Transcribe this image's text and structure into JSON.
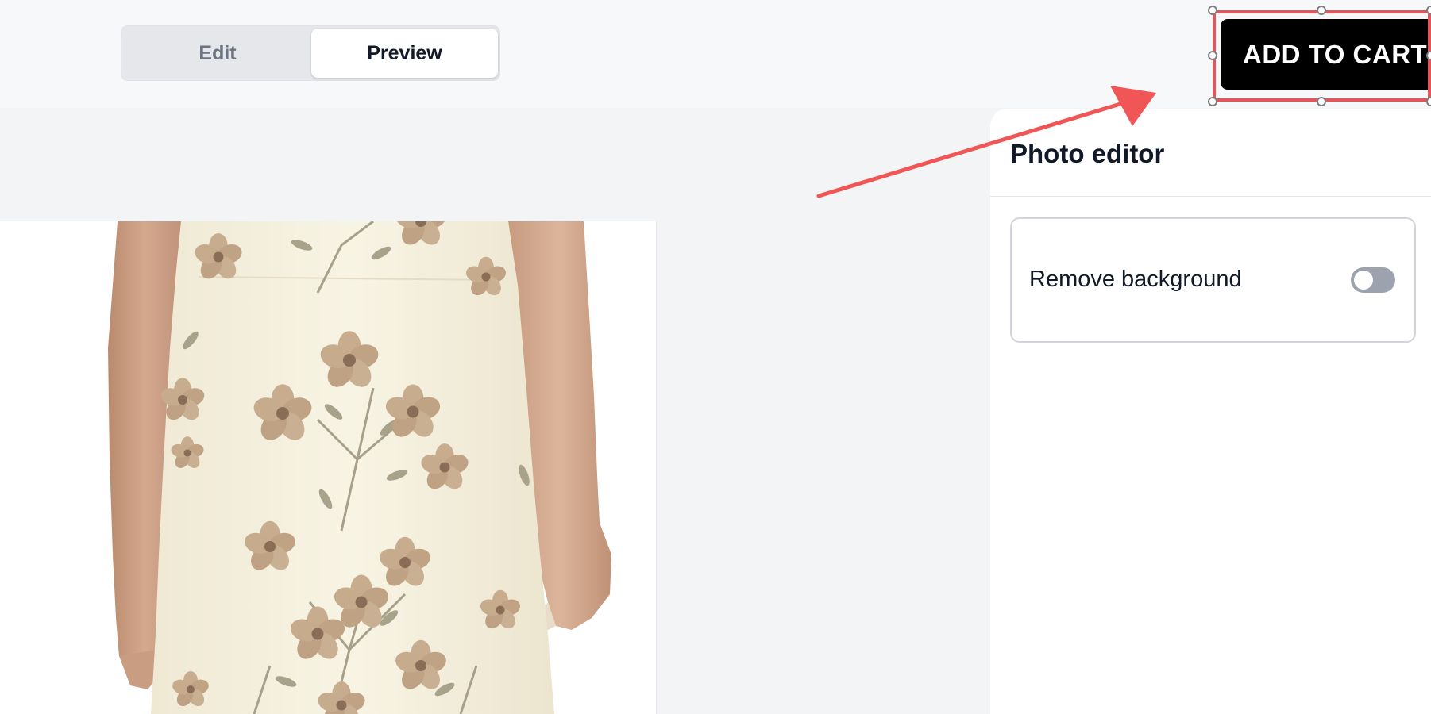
{
  "header": {
    "mode_tabs": [
      {
        "label": "Edit",
        "active": false
      },
      {
        "label": "Preview",
        "active": true
      }
    ],
    "add_to_cart_label": "ADD TO CART"
  },
  "photo_editor": {
    "title": "Photo editor",
    "options": [
      {
        "label": "Remove background",
        "enabled": false
      }
    ]
  },
  "colors": {
    "accent_selection": "#e0575b",
    "annotation_arrow": "#f05656",
    "button_bg": "#000000",
    "toggle_off": "#9ca3af"
  }
}
